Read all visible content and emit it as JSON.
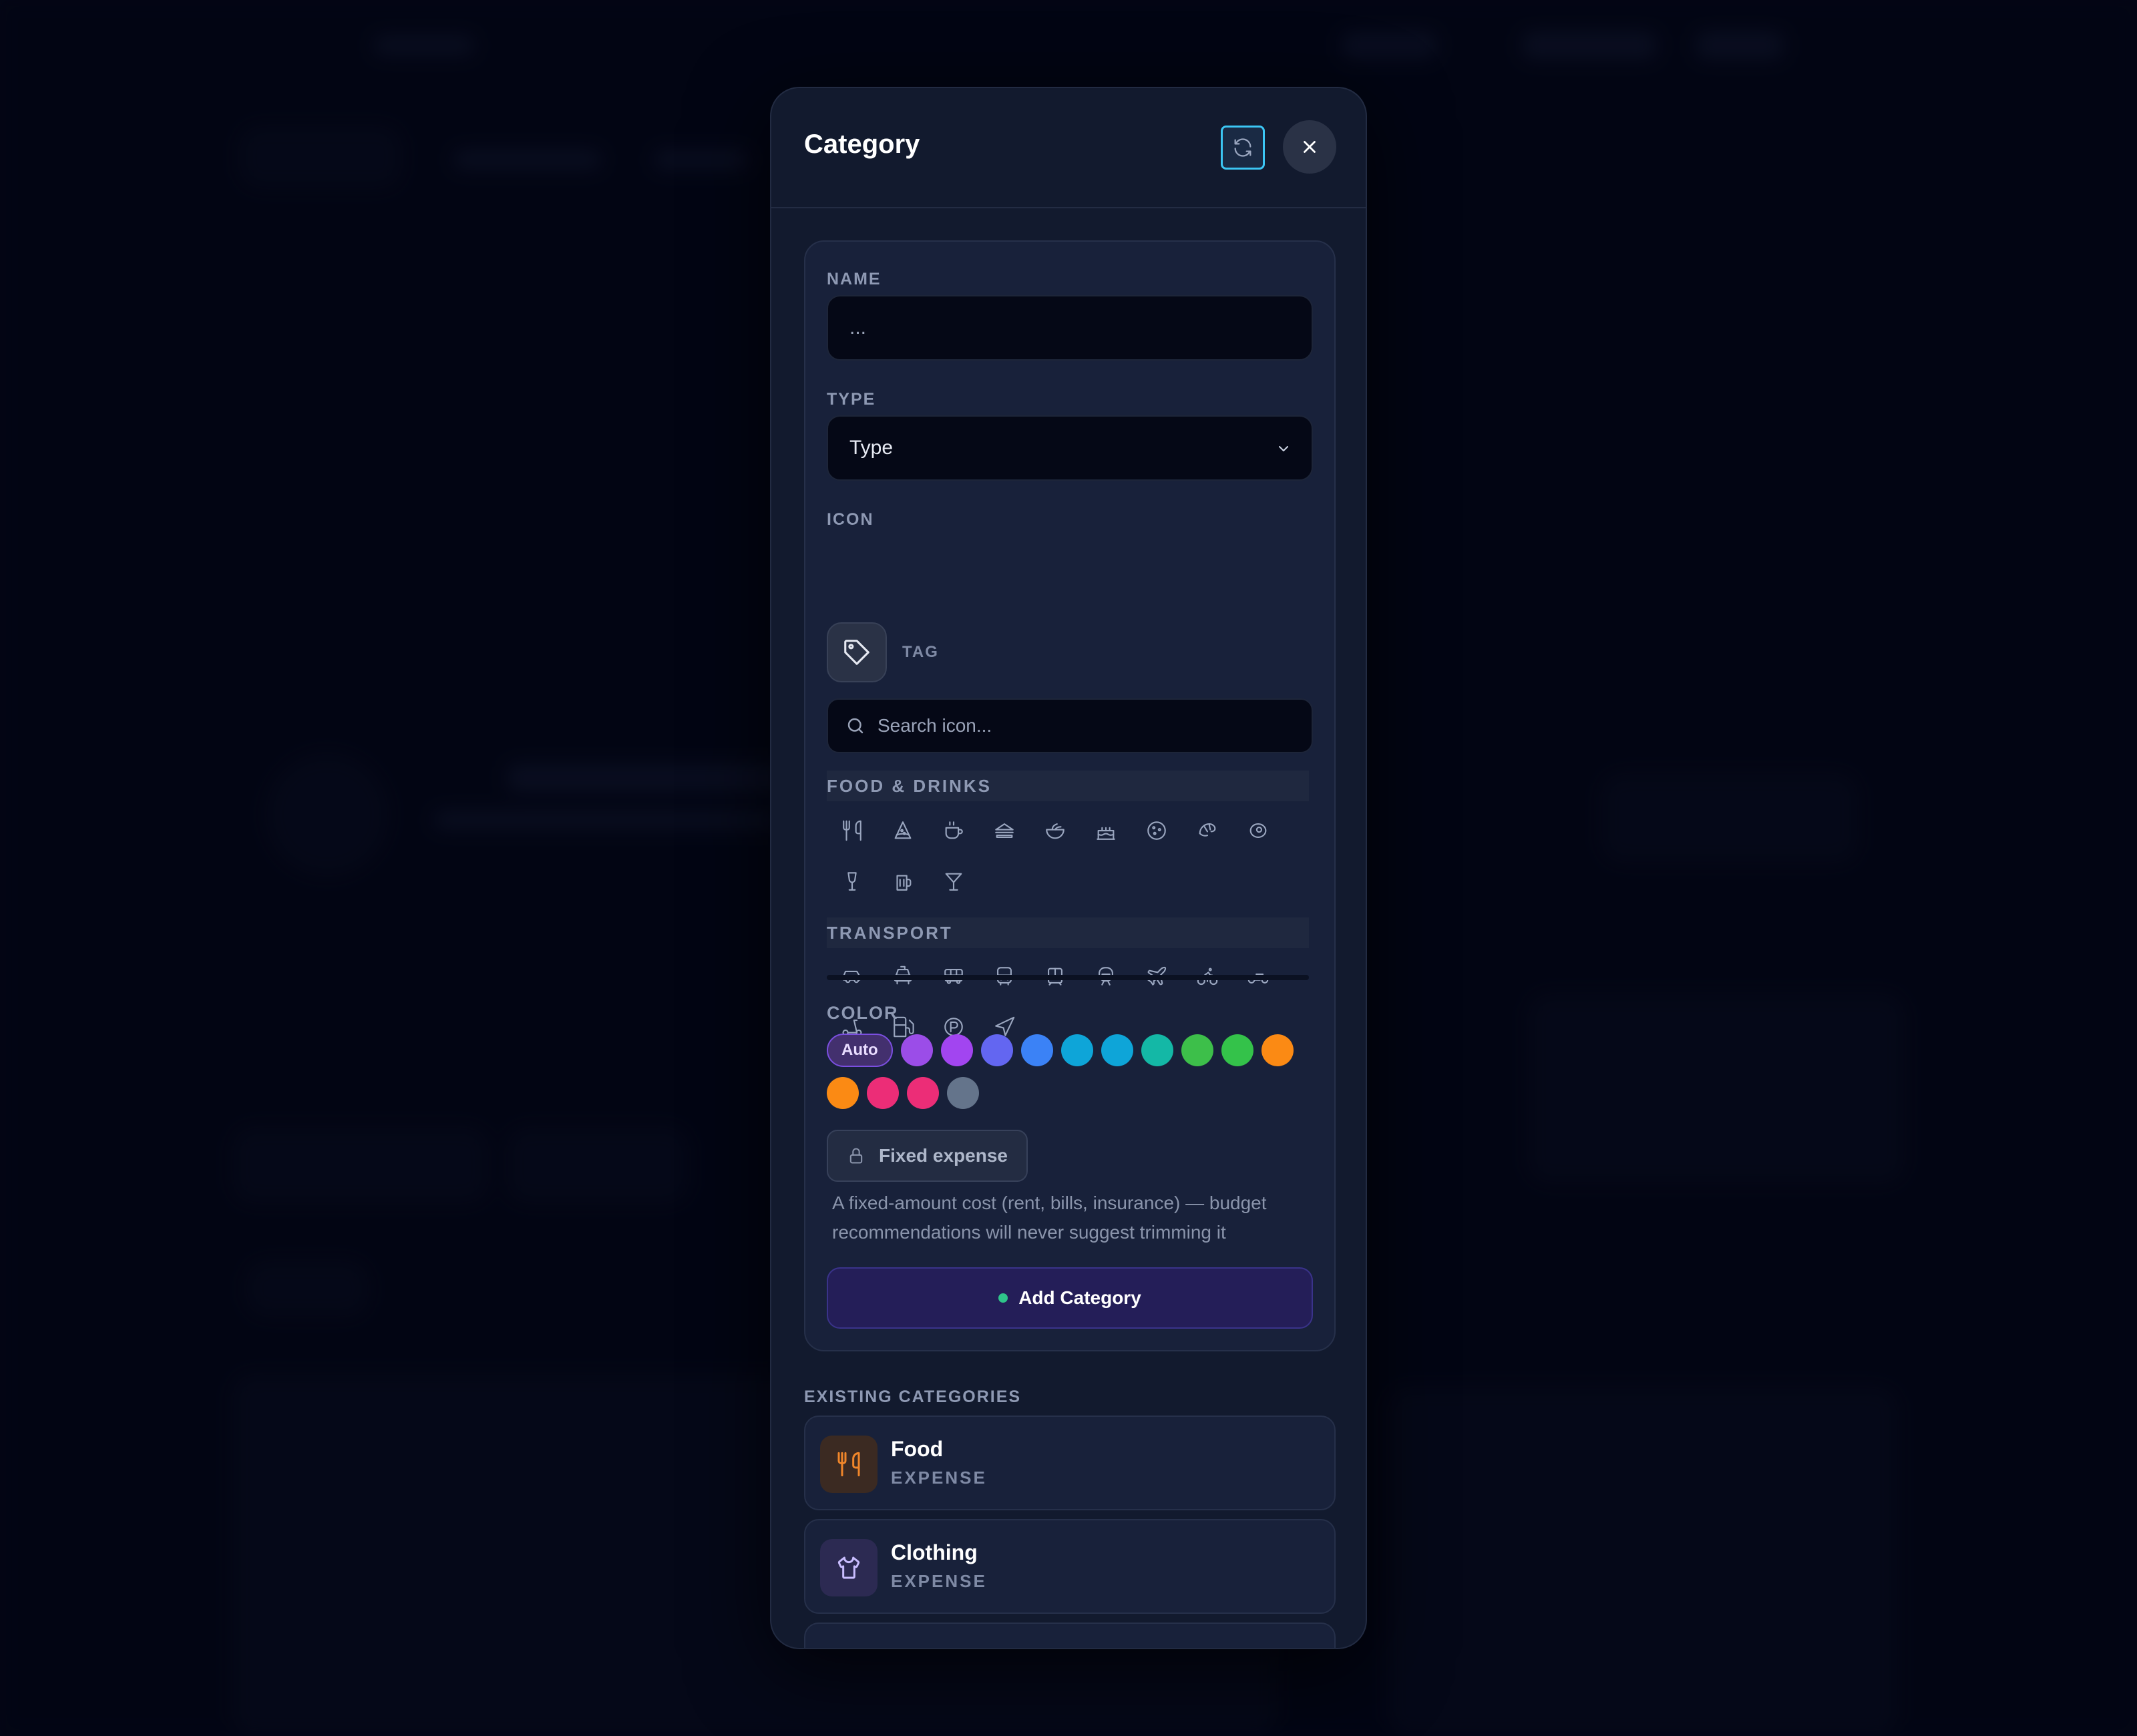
{
  "modal": {
    "title": "Category",
    "refresh_icon": "refresh-icon",
    "close_icon": "close-icon"
  },
  "form": {
    "name_label": "NAME",
    "name_placeholder": "...",
    "type_label": "TYPE",
    "type_value": "Type",
    "icon_label": "ICON",
    "selected_icon": "tag-icon",
    "selected_icon_name": "TAG",
    "icon_search_placeholder": "Search icon...",
    "icon_groups": [
      {
        "title": "FOOD & DRINKS",
        "icons": [
          "utensils-icon",
          "pizza-icon",
          "coffee-icon",
          "sandwich-icon",
          "salad-icon",
          "cake-icon",
          "cookie-icon",
          "croissant-icon",
          "beef-icon",
          "wine-icon",
          "beer-icon",
          "cocktail-icon"
        ]
      },
      {
        "title": "TRANSPORT",
        "icons": [
          "car-icon",
          "taxi-icon",
          "bus-icon",
          "bus-front-icon",
          "tram-icon",
          "train-icon",
          "plane-icon",
          "bike-icon",
          "motorbike-icon",
          "scooter-icon",
          "fuel-icon",
          "parking-icon",
          "navigation-icon"
        ]
      }
    ],
    "color_label": "COLOR",
    "color_auto_label": "Auto",
    "colors": [
      "#9b4de8",
      "#a245f0",
      "#6366f1",
      "#3b82f6",
      "#0ea5d8",
      "#0ea5d8",
      "#14b8a6",
      "#3dbf4a",
      "#34c24a",
      "#fb8a14",
      "#fb8a14",
      "#ec2d77",
      "#ec2d77",
      "#64748b"
    ],
    "fixed_expense_label": "Fixed expense",
    "fixed_expense_desc": "A fixed-amount cost (rent, bills, insurance) — budget recommendations will never suggest trimming it",
    "submit_label": "Add Category"
  },
  "existing": {
    "label": "EXISTING CATEGORIES",
    "items": [
      {
        "name": "Food",
        "type": "EXPENSE",
        "icon": "utensils-icon",
        "color": "#f0862a"
      },
      {
        "name": "Clothing",
        "type": "EXPENSE",
        "icon": "shirt-icon",
        "color": "#b9a6ff"
      }
    ]
  }
}
